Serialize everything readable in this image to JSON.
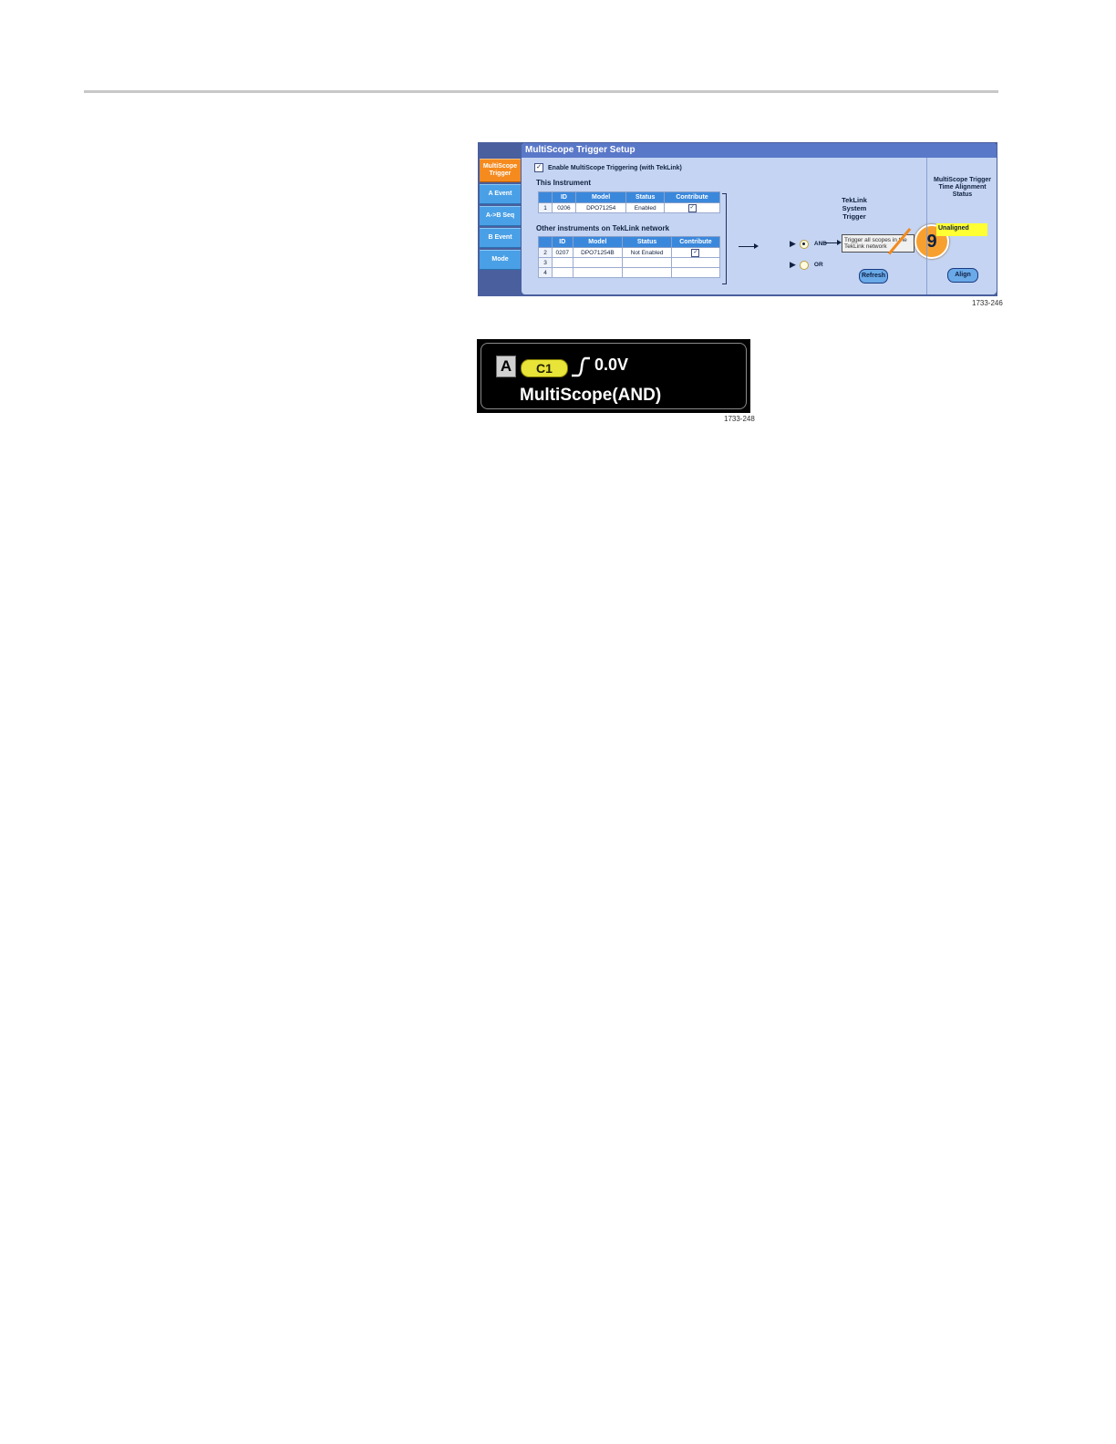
{
  "panel": {
    "title": "MultiScope Trigger Setup",
    "sidebar": [
      {
        "label": "MultiScope Trigger",
        "active": true
      },
      {
        "label": "A Event",
        "active": false
      },
      {
        "label": "A->B Seq",
        "active": false
      },
      {
        "label": "B Event",
        "active": false
      },
      {
        "label": "Mode",
        "active": false
      }
    ],
    "enable_label": "Enable MultiScope Triggering (with TekLink)",
    "enable_checked": "✓",
    "this_instrument_label": "This Instrument",
    "other_instruments_label": "Other instruments on TekLink network",
    "columns": [
      "ID",
      "Model",
      "Status",
      "Contribute"
    ],
    "this_instrument_rows": [
      {
        "n": "1",
        "id": "0206",
        "model": "DPO71254",
        "status": "Enabled",
        "contribute": "✓"
      }
    ],
    "other_rows": [
      {
        "n": "2",
        "id": "0207",
        "model": "DPO71254B",
        "status": "Not Enabled",
        "contribute": "✓"
      },
      {
        "n": "3",
        "id": "",
        "model": "",
        "status": "",
        "contribute": ""
      },
      {
        "n": "4",
        "id": "",
        "model": "",
        "status": "",
        "contribute": ""
      }
    ],
    "teklink_title": "TekLink System Trigger",
    "and_label": "AND",
    "or_label": "OR",
    "selected_mode": "AND",
    "note_text": "Trigger all scopes in the TekLink network",
    "refresh_label": "Refresh",
    "status_title": "MultiScope Trigger Time Alignment Status",
    "status_value": "Unaligned",
    "align_label": "Align",
    "callout_number": "9",
    "figure_id": "1733-246"
  },
  "readout": {
    "source_badge": "A",
    "channel": "C1",
    "level": "0.0V",
    "mode": "MultiScope(AND)",
    "figure_id": "1733-248"
  },
  "colors": {
    "panel_bg": "#4a5f9e",
    "content_bg": "#c4d4f2",
    "header_blue": "#3a88dc",
    "active_tab": "#f58a1e",
    "callout": "#f7a030",
    "status_yellow": "#ffff33",
    "channel_yellow": "#e8e438"
  }
}
